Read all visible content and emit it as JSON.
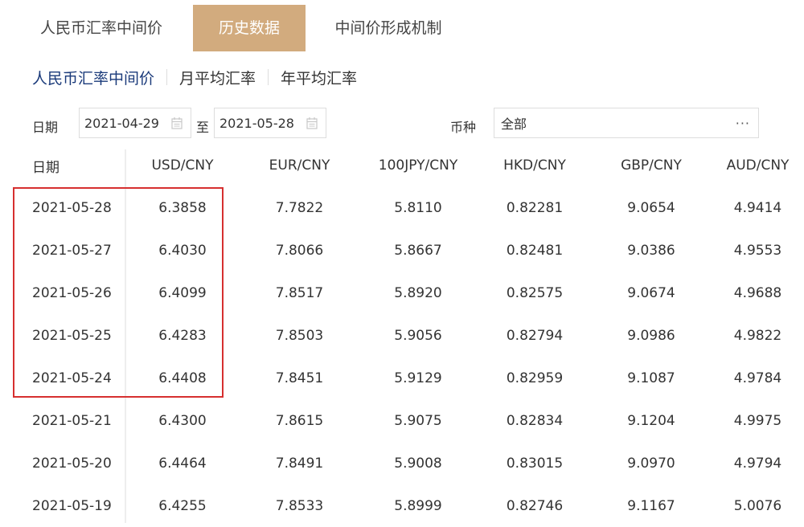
{
  "top_tabs": [
    {
      "label": "人民币汇率中间价",
      "active": false
    },
    {
      "label": "历史数据",
      "active": true
    },
    {
      "label": "中间价形成机制",
      "active": false
    }
  ],
  "sub_tabs": [
    {
      "label": "人民币汇率中间价",
      "active": true
    },
    {
      "label": "月平均汇率",
      "active": false
    },
    {
      "label": "年平均汇率",
      "active": false
    }
  ],
  "filter": {
    "date_label": "日期",
    "start_date": "2021-04-29",
    "to_label": "至",
    "end_date": "2021-05-28",
    "currency_label": "币种",
    "currency_value": "全部"
  },
  "table": {
    "headers": [
      "日期",
      "USD/CNY",
      "EUR/CNY",
      "100JPY/CNY",
      "HKD/CNY",
      "GBP/CNY",
      "AUD/CNY"
    ],
    "rows": [
      [
        "2021-05-28",
        "6.3858",
        "7.7822",
        "5.8110",
        "0.82281",
        "9.0654",
        "4.9414"
      ],
      [
        "2021-05-27",
        "6.4030",
        "7.8066",
        "5.8667",
        "0.82481",
        "9.0386",
        "4.9553"
      ],
      [
        "2021-05-26",
        "6.4099",
        "7.8517",
        "5.8920",
        "0.82575",
        "9.0674",
        "4.9688"
      ],
      [
        "2021-05-25",
        "6.4283",
        "7.8503",
        "5.9056",
        "0.82794",
        "9.0986",
        "4.9822"
      ],
      [
        "2021-05-24",
        "6.4408",
        "7.8451",
        "5.9129",
        "0.82959",
        "9.1087",
        "4.9784"
      ],
      [
        "2021-05-21",
        "6.4300",
        "7.8615",
        "5.9075",
        "0.82834",
        "9.1204",
        "4.9975"
      ],
      [
        "2021-05-20",
        "6.4464",
        "7.8491",
        "5.9008",
        "0.83015",
        "9.0970",
        "4.9794"
      ],
      [
        "2021-05-19",
        "6.4255",
        "7.8533",
        "5.8999",
        "0.82746",
        "9.1167",
        "5.0076"
      ]
    ]
  },
  "colors": {
    "accent": "#d2ab7e",
    "active_link": "#1a3a7a",
    "highlight": "#d62f2f"
  }
}
